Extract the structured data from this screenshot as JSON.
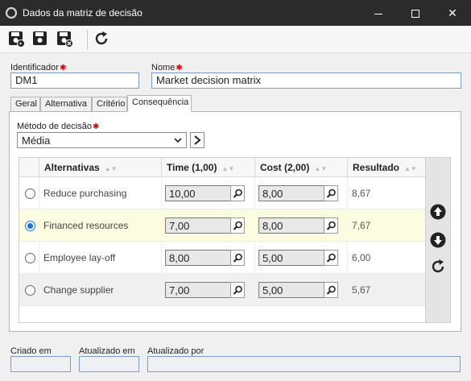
{
  "window": {
    "title": "Dados da matriz de decisão"
  },
  "toolbar": {
    "save_new_icon": "save-new-icon",
    "save_icon": "save-icon",
    "save_close_icon": "save-close-icon",
    "refresh_icon": "refresh-icon"
  },
  "form": {
    "identifier_label": "Identificador",
    "identifier_value": "DM1",
    "name_label": "Nome",
    "name_value": "Market decision matrix"
  },
  "tabs": [
    {
      "label": "Geral"
    },
    {
      "label": "Alternativa"
    },
    {
      "label": "Critério"
    },
    {
      "label": "Consequência",
      "active": true
    }
  ],
  "consequence": {
    "method_label": "Método de decisão",
    "method_value": "Média",
    "columns": [
      "Alternativas",
      "Time (1,00)",
      "Cost (2,00)",
      "Resultado"
    ],
    "rows": [
      {
        "alternative": "Reduce purchasing",
        "time": "10,00",
        "cost": "8,00",
        "result": "8,67",
        "selected": false
      },
      {
        "alternative": "Financed resources",
        "time": "7,00",
        "cost": "8,00",
        "result": "7,67",
        "selected": true
      },
      {
        "alternative": "Employee lay-off",
        "time": "8,00",
        "cost": "5,00",
        "result": "6,00",
        "selected": false
      },
      {
        "alternative": "Change supplier",
        "time": "7,00",
        "cost": "5,00",
        "result": "5,67",
        "selected": false
      }
    ]
  },
  "footer": {
    "created_label": "Criado em",
    "created_value": "",
    "updated_label": "Atualizado em",
    "updated_value": "",
    "updated_by_label": "Atualizado por",
    "updated_by_value": ""
  },
  "colors": {
    "accent": "#1a73e8",
    "selected_row": "#fcfce0",
    "required": "#dd0000"
  }
}
